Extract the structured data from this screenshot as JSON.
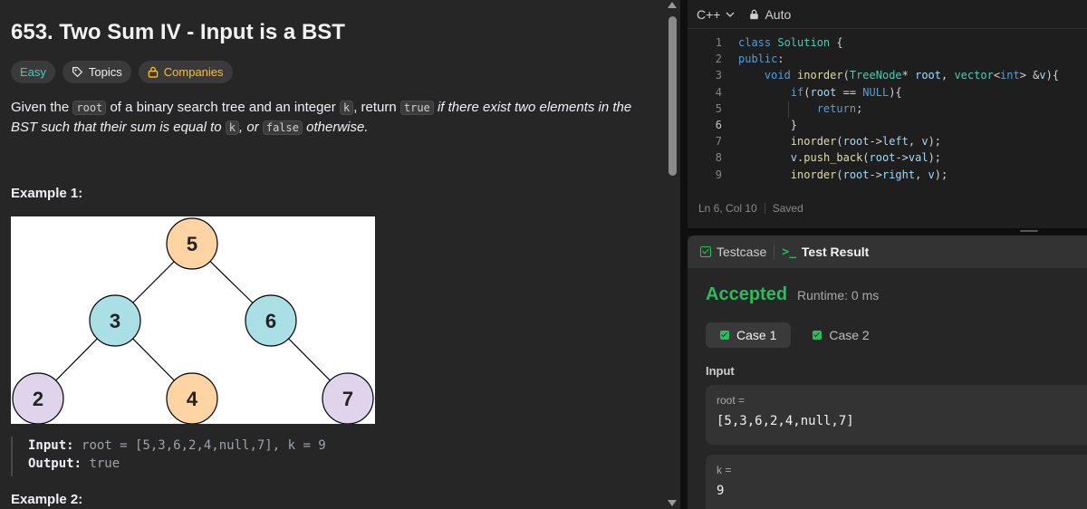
{
  "problem": {
    "title": "653. Two Sum IV - Input is a BST",
    "tags": {
      "difficulty": "Easy",
      "topics": "Topics",
      "companies": "Companies"
    },
    "description": {
      "p1": "Given the ",
      "c1": "root",
      "p2": " of a binary search tree and an integer ",
      "c2": "k",
      "p3": ", return ",
      "c3": "true",
      "p4": " if there exist two elements in the BST such that their sum is equal to ",
      "c4": "k",
      "p5": ", or ",
      "c5": "false",
      "p6": " otherwise."
    },
    "example1": {
      "heading": "Example 1:",
      "tree_nodes": [
        "5",
        "3",
        "6",
        "2",
        "4",
        "7"
      ],
      "input_label": "Input:",
      "input_value": "root = [5,3,6,2,4,null,7], k = 9",
      "output_label": "Output:",
      "output_value": "true"
    },
    "example2": {
      "heading": "Example 2:"
    }
  },
  "editor": {
    "language": "C++",
    "mode": "Auto",
    "lines": [
      {
        "n": "1",
        "tokens": [
          [
            "kw",
            "class "
          ],
          [
            "ty",
            "Solution "
          ],
          [
            "ct",
            "{"
          ]
        ]
      },
      {
        "n": "2",
        "tokens": [
          [
            "kw",
            "public"
          ],
          [
            "ct",
            ":"
          ]
        ]
      },
      {
        "n": "3",
        "tokens": [
          [
            "ct",
            "    "
          ],
          [
            "kw",
            "void "
          ],
          [
            "fn",
            "inorder"
          ],
          [
            "ct",
            "("
          ],
          [
            "ty",
            "TreeNode"
          ],
          [
            "ct",
            "* "
          ],
          [
            "id",
            "root"
          ],
          [
            "ct",
            ", "
          ],
          [
            "ty",
            "vector"
          ],
          [
            "ct",
            "<"
          ],
          [
            "kw",
            "int"
          ],
          [
            "ct",
            "> &"
          ],
          [
            "id",
            "v"
          ],
          [
            "ct",
            "){"
          ]
        ]
      },
      {
        "n": "4",
        "tokens": [
          [
            "ct",
            "        "
          ],
          [
            "kw",
            "if"
          ],
          [
            "ct",
            "("
          ],
          [
            "id",
            "root"
          ],
          [
            "ct",
            " == "
          ],
          [
            "kw",
            "NULL"
          ],
          [
            "ct",
            "){"
          ]
        ]
      },
      {
        "n": "5",
        "tokens": [
          [
            "ct",
            "            "
          ],
          [
            "kw",
            "return"
          ],
          [
            "ct",
            ";"
          ]
        ]
      },
      {
        "n": "6",
        "tokens": [
          [
            "ct",
            "        }"
          ]
        ]
      },
      {
        "n": "7",
        "tokens": [
          [
            "ct",
            "        "
          ],
          [
            "fn",
            "inorder"
          ],
          [
            "ct",
            "("
          ],
          [
            "id",
            "root"
          ],
          [
            "ct",
            "->"
          ],
          [
            "id",
            "left"
          ],
          [
            "ct",
            ", "
          ],
          [
            "id",
            "v"
          ],
          [
            "ct",
            ");"
          ]
        ]
      },
      {
        "n": "8",
        "tokens": [
          [
            "ct",
            "        "
          ],
          [
            "id",
            "v"
          ],
          [
            "ct",
            "."
          ],
          [
            "fn",
            "push_back"
          ],
          [
            "ct",
            "("
          ],
          [
            "id",
            "root"
          ],
          [
            "ct",
            "->"
          ],
          [
            "id",
            "val"
          ],
          [
            "ct",
            ");"
          ]
        ]
      },
      {
        "n": "9",
        "tokens": [
          [
            "ct",
            "        "
          ],
          [
            "fn",
            "inorder"
          ],
          [
            "ct",
            "("
          ],
          [
            "id",
            "root"
          ],
          [
            "ct",
            "->"
          ],
          [
            "id",
            "right"
          ],
          [
            "ct",
            ", "
          ],
          [
            "id",
            "v"
          ],
          [
            "ct",
            ");"
          ]
        ]
      }
    ],
    "active_line": "6",
    "status": {
      "position": "Ln 6, Col 10",
      "saved": "Saved"
    }
  },
  "result_panel": {
    "tabs": {
      "testcase": "Testcase",
      "test_result": "Test Result"
    },
    "verdict": "Accepted",
    "runtime": "Runtime: 0 ms",
    "cases": [
      "Case 1",
      "Case 2"
    ],
    "input_label": "Input",
    "fields": [
      {
        "name": "root =",
        "value": "[5,3,6,2,4,null,7]"
      },
      {
        "name": "k =",
        "value": "9"
      }
    ]
  },
  "colors": {
    "accent_green": "#2cbb5d",
    "easy": "#46c6c2",
    "companies": "#ffc01e",
    "node_orange": "#fed4a5",
    "node_teal": "#aadfe6",
    "node_purple": "#e0d3ec"
  }
}
